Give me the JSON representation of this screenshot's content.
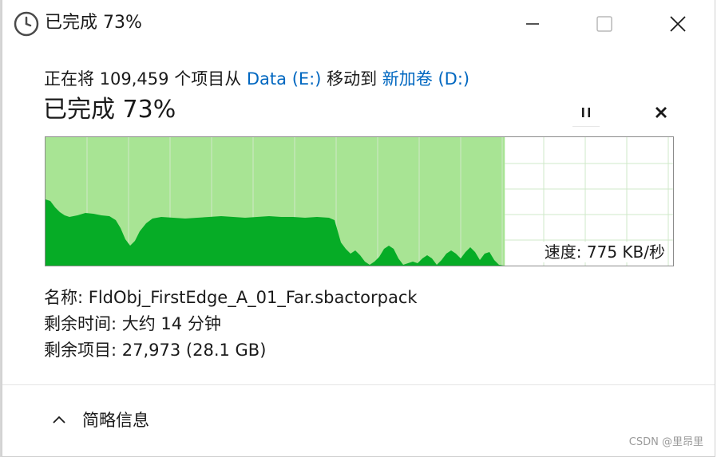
{
  "window": {
    "title": "已完成 73%",
    "clock_icon": "clock-icon",
    "controls": {
      "minimize_icon": "minimize-icon",
      "maximize_icon": "maximize-icon",
      "close_icon": "close-icon"
    }
  },
  "transfer": {
    "prefix": "正在将 109,459 个项目从 ",
    "source": "Data (E:)",
    "middle": " 移动到 ",
    "destination": "新加卷 (D:)",
    "status": "已完成 73%",
    "progress_percent": 73,
    "pause_icon": "pause-icon",
    "stop_icon": "stop-icon",
    "speed_text": "速度: 775 KB/秒"
  },
  "details": {
    "name_line": "名称: FldObj_FirstEdge_A_01_Far.sbactorpack",
    "time_line": "剩余时间: 大约 14 分钟",
    "items_line": "剩余项目: 27,973 (28.1 GB)"
  },
  "footer": {
    "toggle_label": "简略信息",
    "toggle_icon": "chevron-up-icon"
  },
  "watermark": "CSDN @里昂里",
  "colors": {
    "progress_fill": "#a8e494",
    "speed_fill": "#06ac26",
    "grid_line": "#cfe9c8",
    "link": "#0067c0"
  }
}
